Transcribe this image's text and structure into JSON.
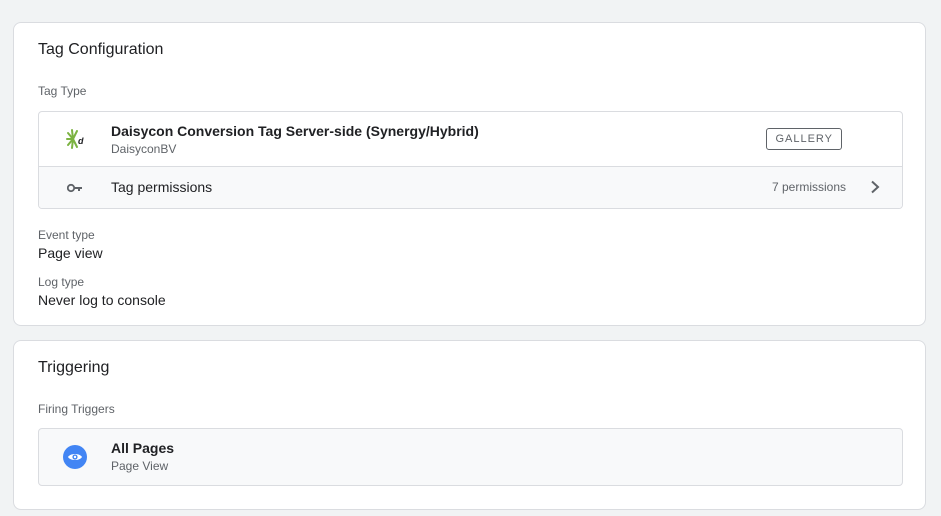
{
  "tag_configuration": {
    "title": "Tag Configuration",
    "tag_type_label": "Tag Type",
    "tag": {
      "name": "Daisycon Conversion Tag Server-side (Synergy/Hybrid)",
      "publisher": "DaisyconBV",
      "gallery_label": "GALLERY"
    },
    "permissions": {
      "label": "Tag permissions",
      "count": "7 permissions"
    },
    "event_type": {
      "label": "Event type",
      "value": "Page view"
    },
    "log_type": {
      "label": "Log type",
      "value": "Never log to console"
    }
  },
  "triggering": {
    "title": "Triggering",
    "firing_label": "Firing Triggers",
    "trigger": {
      "name": "All Pages",
      "type": "Page View"
    }
  },
  "colors": {
    "accent_blue": "#4285f4",
    "logo_green": "#7cb342",
    "border": "#dadce0",
    "muted_text": "#5f6368"
  },
  "icons": [
    "daisycon-logo-icon",
    "key-icon",
    "chevron-right-icon",
    "eye-icon"
  ]
}
